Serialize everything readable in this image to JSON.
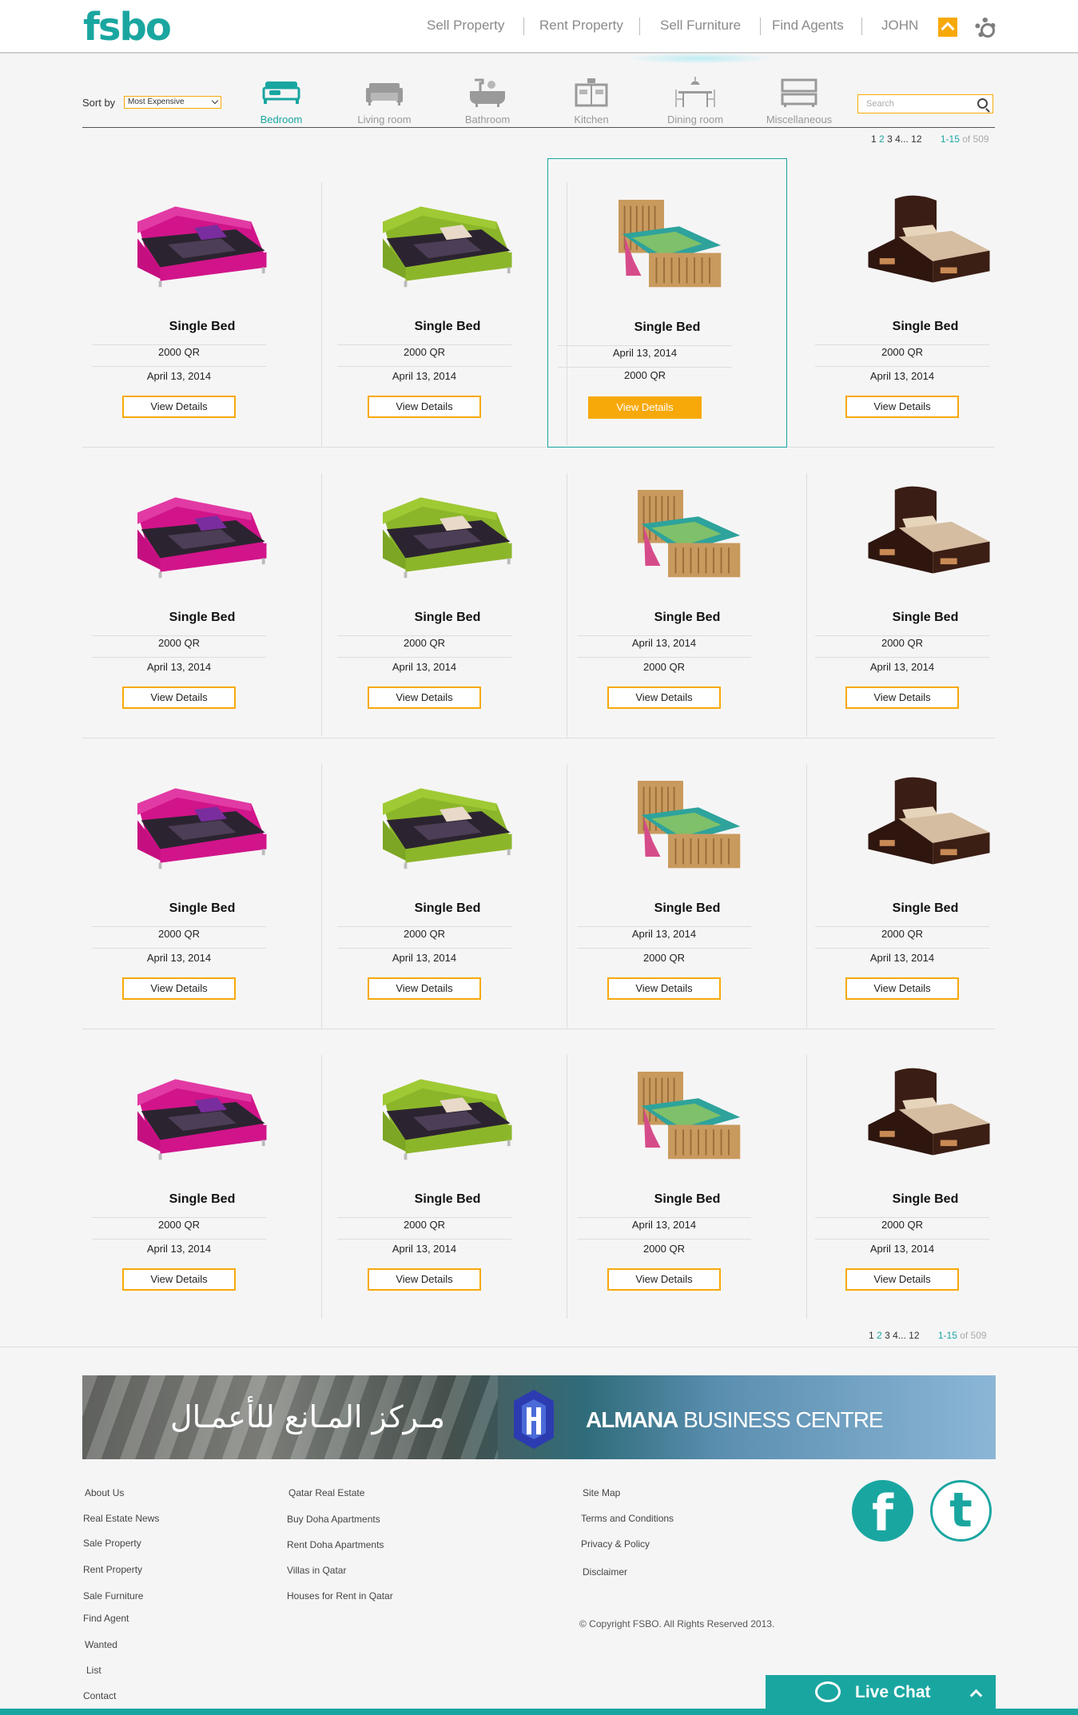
{
  "header": {
    "logo": "fsbo",
    "nav": [
      {
        "label": "Sell Property"
      },
      {
        "label": "Rent Property"
      },
      {
        "label": "Sell Furniture"
      },
      {
        "label": "Find Agents"
      },
      {
        "label": "JOHN"
      }
    ]
  },
  "filter": {
    "sort_label": "Sort by",
    "sort_value": "Most Expensive",
    "categories": [
      {
        "label": "Bedroom",
        "icon": "bed-icon",
        "active": true
      },
      {
        "label": "Living room",
        "icon": "sofa-icon"
      },
      {
        "label": "Bathroom",
        "icon": "bathtub-icon"
      },
      {
        "label": "Kitchen",
        "icon": "kitchen-icon"
      },
      {
        "label": "Dining room",
        "icon": "dining-table-icon"
      },
      {
        "label": "Miscellaneous",
        "icon": "cabinet-icon"
      }
    ],
    "search_placeholder": "Search"
  },
  "pagination": {
    "p1": "1",
    "p2": "2",
    "p3": "3",
    "p4": "4",
    "ellipsis": "...",
    "last": "12",
    "range": "1-15",
    "of": "of 509"
  },
  "products": [
    {
      "title": "Single Bed",
      "price": "2000 QR",
      "date": "April 13, 2014",
      "button": "View Details",
      "image": "pink-bed"
    },
    {
      "title": "Single Bed",
      "price": "2000 QR",
      "date": "April 13, 2014",
      "button": "View Details",
      "image": "green-bed"
    },
    {
      "title": "Single Bed",
      "price": "2000 QR",
      "date": "April 13, 2014",
      "button": "View Details",
      "image": "wood-bed"
    },
    {
      "title": "Single Bed",
      "price": "2000 QR",
      "date": "April 13, 2014",
      "button": "View Details",
      "image": "dark-bed"
    }
  ],
  "banner": {
    "arabic": "مـركز المـانع للأعمـال",
    "name_bold": "ALMANA",
    "name_rest": " BUSINESS CENTRE"
  },
  "footer": {
    "col1": [
      "About Us",
      "Real Estate News",
      "Sale Property",
      "Rent Property",
      "Sale Furniture",
      "Find Agent",
      "Wanted",
      "List",
      "Contact"
    ],
    "col2": [
      "Qatar Real Estate",
      "Buy Doha Apartments",
      "Rent Doha Apartments",
      "Villas in Qatar",
      "Houses for Rent in Qatar"
    ],
    "col3": [
      "Site Map",
      "Terms and Conditions",
      "Privacy & Policy",
      "Disclaimer"
    ],
    "copyright": "© Copyright FSBO. All Rights Reserved 2013."
  },
  "livechat": {
    "label": "Live Chat"
  },
  "colors": {
    "accent": "#1aa6a0",
    "highlight": "#f7a90a"
  }
}
